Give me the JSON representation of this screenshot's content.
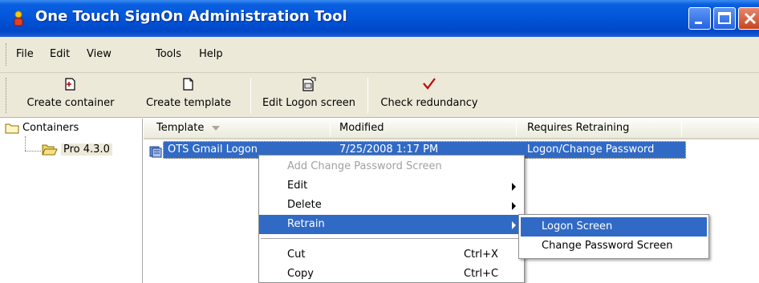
{
  "window": {
    "title": "One Touch SignOn Administration Tool"
  },
  "menubar": {
    "items": [
      "File",
      "Edit",
      "View",
      "Tools",
      "Help"
    ]
  },
  "toolbar": {
    "buttons": [
      {
        "label": "Create container",
        "icon": "new-container-icon"
      },
      {
        "label": "Create template",
        "icon": "new-document-icon"
      },
      {
        "label": "Edit Logon screen",
        "icon": "edit-screen-icon"
      },
      {
        "label": "Check redundancy",
        "icon": "checkmark-icon"
      }
    ]
  },
  "tree": {
    "root": "Containers",
    "child": "Pro 4.3.0"
  },
  "list": {
    "columns": [
      "Template",
      "Modified",
      "Requires Retraining"
    ],
    "rows": [
      {
        "template": "OTS Gmail Logon",
        "modified": "7/25/2008 1:17 PM",
        "requires_retraining": "Logon/Change Password"
      }
    ]
  },
  "context_menu": {
    "items": [
      {
        "label": "Add Change Password Screen",
        "disabled": true
      },
      {
        "label": "Edit",
        "submenu": true
      },
      {
        "label": "Delete",
        "submenu": true
      },
      {
        "label": "Retrain",
        "submenu": true,
        "active": true
      },
      {
        "label": "Cut",
        "shortcut": "Ctrl+X"
      },
      {
        "label": "Copy",
        "shortcut": "Ctrl+C"
      }
    ]
  },
  "submenu": {
    "items": [
      "Logon Screen",
      "Change Password Screen"
    ]
  },
  "colors": {
    "titlebar": "#0254d8",
    "selection": "#316ac5",
    "chrome": "#ece9d8",
    "check_red": "#c00000"
  }
}
